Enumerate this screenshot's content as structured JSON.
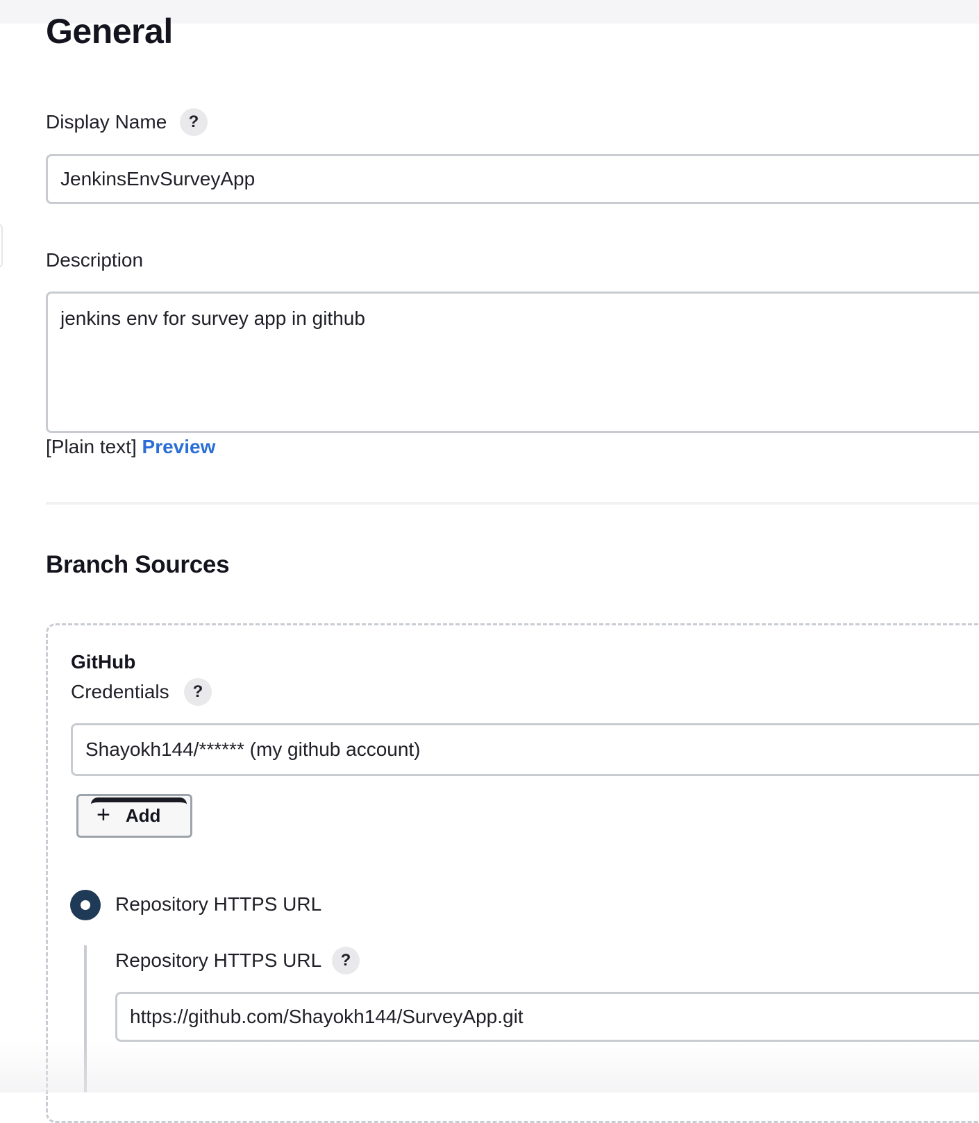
{
  "general": {
    "title": "General",
    "display_name": {
      "label": "Display Name",
      "help": "?",
      "value": "JenkinsEnvSurveyApp"
    },
    "description": {
      "label": "Description",
      "value": "jenkins env for survey app in github",
      "format_text": "[Plain text]",
      "preview_link": "Preview"
    }
  },
  "branch_sources": {
    "title": "Branch Sources",
    "source": {
      "heading": "GitHub",
      "credentials": {
        "label": "Credentials",
        "help": "?",
        "selected": "Shayokh144/****** (my github account)"
      },
      "add_button": {
        "icon": "plus-icon",
        "label": "Add"
      },
      "repo_option": {
        "label": "Repository HTTPS URL",
        "selected": true
      },
      "repo_url": {
        "label": "Repository HTTPS URL",
        "help": "?",
        "value": "https://github.com/Shayokh144/SurveyApp.git"
      }
    }
  },
  "colors": {
    "link": "#2b6fd6",
    "radio_selected": "#1f3a57",
    "input_border": "#c8ccd1"
  }
}
